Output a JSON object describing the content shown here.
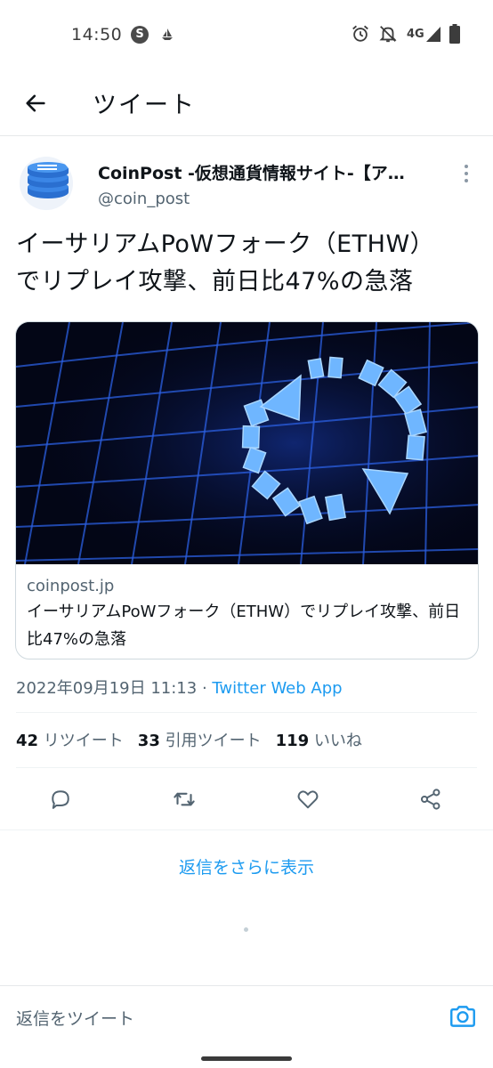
{
  "status_bar": {
    "time": "14:50",
    "s_badge": "S",
    "network": "4G"
  },
  "header": {
    "title": "ツイート"
  },
  "tweet": {
    "author_name": "CoinPost -仮想通貨情報サイト-【ア…",
    "author_handle": "@coin_post",
    "text_line1": "イーサリアムPoWフォーク（ETHW）",
    "text_line2": "でリプレイ攻撃、前日比47%の急落",
    "card": {
      "domain": "coinpost.jp",
      "title": "イーサリアムPoWフォーク（ETHW）でリプレイ攻撃、前日比47%の急落"
    },
    "timestamp": "2022年09月19日 11:13",
    "separator": " · ",
    "source": "Twitter Web App",
    "stats": {
      "retweets_count": "42",
      "retweets_label": "リツイート",
      "quotes_count": "33",
      "quotes_label": "引用ツイート",
      "likes_count": "119",
      "likes_label": "いいね"
    }
  },
  "more_replies_label": "返信をさらに表示",
  "reply_bar": {
    "placeholder": "返信をツイート"
  },
  "colors": {
    "accent": "#1d9bf0",
    "text_primary": "#0f1419",
    "text_secondary": "#536471",
    "divider": "#eff3f4"
  },
  "icons": {
    "back": "arrow-left-icon",
    "more": "more-vertical-icon",
    "reply": "reply-icon",
    "retweet": "retweet-icon",
    "like": "heart-icon",
    "share": "share-icon",
    "camera": "camera-icon"
  }
}
